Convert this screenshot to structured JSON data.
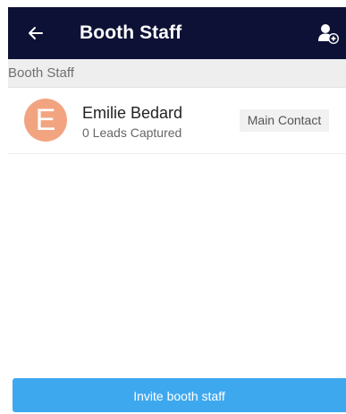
{
  "appbar": {
    "title": "Booth Staff",
    "back_icon": "arrow-left-icon",
    "add_icon": "add-person-icon",
    "background": "#0d1136"
  },
  "section": {
    "label": "Booth Staff"
  },
  "staff": [
    {
      "initial": "E",
      "name": "Emilie Bedard",
      "leads": "0 Leads Captured",
      "badge": "Main Contact",
      "avatar_color": "#f2a481"
    }
  ],
  "footer": {
    "invite_label": "Invite booth staff",
    "button_color": "#3ea8ef"
  }
}
